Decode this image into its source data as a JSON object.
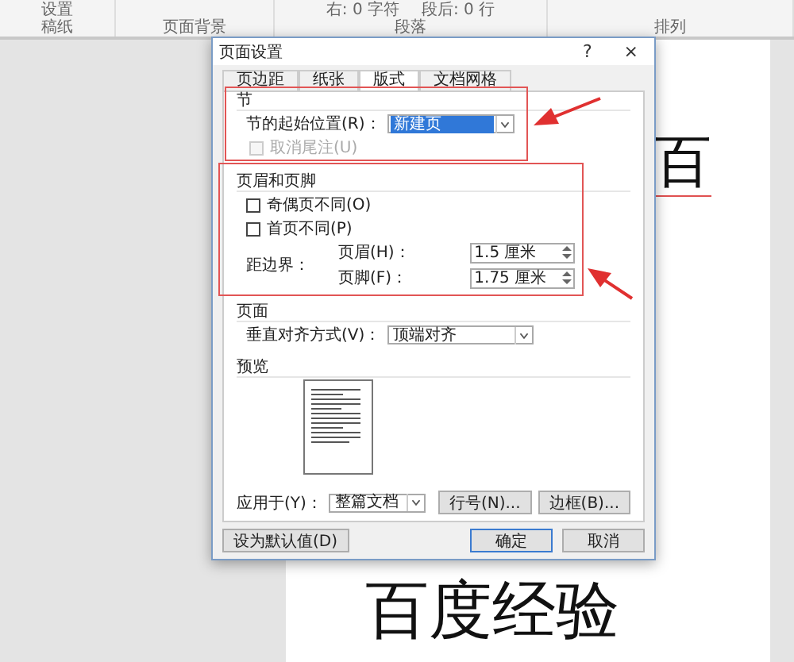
{
  "ribbon": {
    "groups": [
      {
        "top": [
          "设置"
        ],
        "label": "稿纸"
      },
      {
        "label": "页面背景"
      },
      {
        "top": [
          "右: 0 字符",
          "段后: 0 行"
        ],
        "label": "段落"
      },
      {
        "label": "排列"
      }
    ]
  },
  "document": {
    "heading_fragment": "百",
    "heading": "百度经验"
  },
  "dialog": {
    "title": "页面设置",
    "help": "?",
    "close": "×",
    "tabs": [
      {
        "label": "页边距",
        "selected": false
      },
      {
        "label": "纸张",
        "selected": false
      },
      {
        "label": "版式",
        "selected": true
      },
      {
        "label": "文档网格",
        "selected": false
      }
    ],
    "section_start": {
      "group": "节",
      "label": "节的起始位置(R)：",
      "value": "新建页",
      "suppress_endnotes": {
        "label": "取消尾注(U)",
        "checked": false,
        "disabled": true
      }
    },
    "headers_footers": {
      "group": "页眉和页脚",
      "checks": [
        {
          "label": "奇偶页不同(O)",
          "checked": false
        },
        {
          "label": "首页不同(P)",
          "checked": false
        }
      ],
      "distance_label": "距边界：",
      "fields": [
        {
          "label": "页眉(H)：",
          "value": "1.5 厘米"
        },
        {
          "label": "页脚(F)：",
          "value": "1.75 厘米"
        }
      ]
    },
    "page": {
      "group": "页面",
      "label": "垂直对齐方式(V)：",
      "value": "顶端对齐"
    },
    "preview": {
      "group": "预览"
    },
    "apply_to": {
      "label": "应用于(Y)：",
      "value": "整篇文档"
    },
    "side_buttons": [
      "行号(N)...",
      "边框(B)..."
    ],
    "footer_buttons": [
      {
        "label": "设为默认值(D)",
        "default": false
      },
      {
        "label": "确定",
        "default": true
      },
      {
        "label": "取消",
        "default": false
      }
    ]
  }
}
